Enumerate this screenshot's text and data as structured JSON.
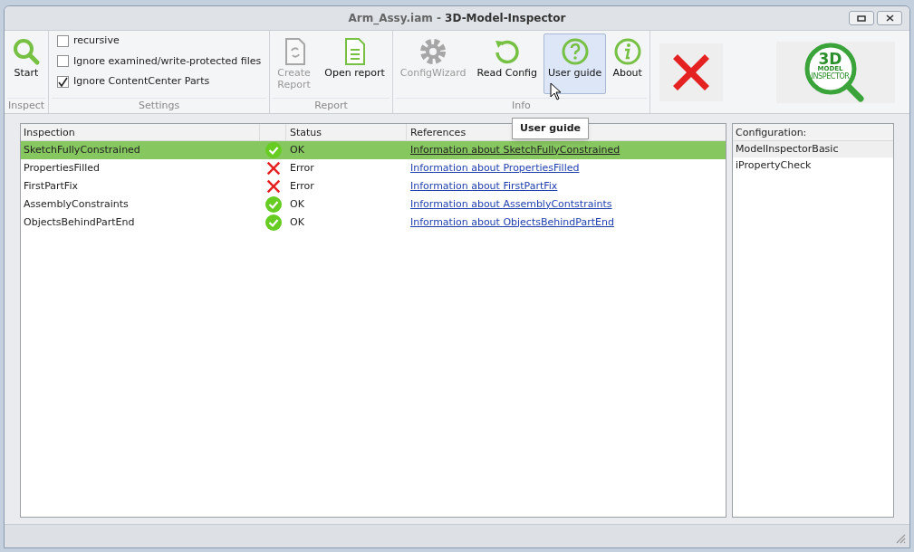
{
  "window": {
    "title": "Arm_Assy.iam - **3D-Model-Inspector**"
  },
  "ribbon": {
    "groups": [
      {
        "label": "Inspect",
        "kind": "buttons",
        "buttons": [
          {
            "label": "Start",
            "kind": "search",
            "disabled": false,
            "highlighted": false
          }
        ]
      },
      {
        "label": "Settings",
        "kind": "checkboxes",
        "checkboxes": [
          {
            "label": "recursive",
            "checked": false
          },
          {
            "label": "Ignore examined/write-protected files",
            "checked": false
          },
          {
            "label": "Ignore ContentCenter Parts",
            "checked": true
          }
        ]
      },
      {
        "label": "Report",
        "kind": "buttons",
        "buttons": [
          {
            "label": "Create Report",
            "kind": "report",
            "disabled": true,
            "highlighted": false
          },
          {
            "label": "Open report",
            "kind": "document",
            "disabled": false,
            "highlighted": false
          }
        ]
      },
      {
        "label": "Info",
        "kind": "buttons",
        "buttons": [
          {
            "label": "ConfigWizard",
            "kind": "gear",
            "disabled": true,
            "highlighted": false
          },
          {
            "label": "Read Config",
            "kind": "reload",
            "disabled": false,
            "highlighted": false
          },
          {
            "label": "User guide",
            "kind": "question",
            "disabled": false,
            "highlighted": true
          },
          {
            "label": "About",
            "kind": "info",
            "disabled": false,
            "highlighted": false
          }
        ]
      }
    ]
  },
  "logo": {
    "line_1": "3D",
    "line_2": "MODEL",
    "line_3": "INSPECTOR"
  },
  "tooltip": "User guide",
  "table": {
    "columns": [
      "Inspection",
      "Status",
      "References"
    ],
    "rows": [
      {
        "inspection": "SketchFullyConstrained",
        "kind": "ok",
        "status": "OK",
        "reference": "Information about SketchFullyConstrained",
        "selected": true
      },
      {
        "inspection": "PropertiesFilled",
        "kind": "error",
        "status": "Error",
        "reference": "Information about PropertiesFilled",
        "selected": false
      },
      {
        "inspection": "FirstPartFix",
        "kind": "error",
        "status": "Error",
        "reference": "Information about FirstPartFix",
        "selected": false
      },
      {
        "inspection": "AssemblyConstraints",
        "kind": "ok",
        "status": "OK",
        "reference": "Information about AssemblyContstraints",
        "selected": false
      },
      {
        "inspection": "ObjectsBehindPartEnd",
        "kind": "ok",
        "status": "OK",
        "reference": "Information about ObjectsBehindPartEnd",
        "selected": false
      }
    ]
  },
  "configuration": {
    "header": "Configuration:",
    "items": [
      {
        "label": "ModelInspectorBasic",
        "selected": true
      },
      {
        "label": "iPropertyCheck",
        "selected": false
      }
    ]
  }
}
